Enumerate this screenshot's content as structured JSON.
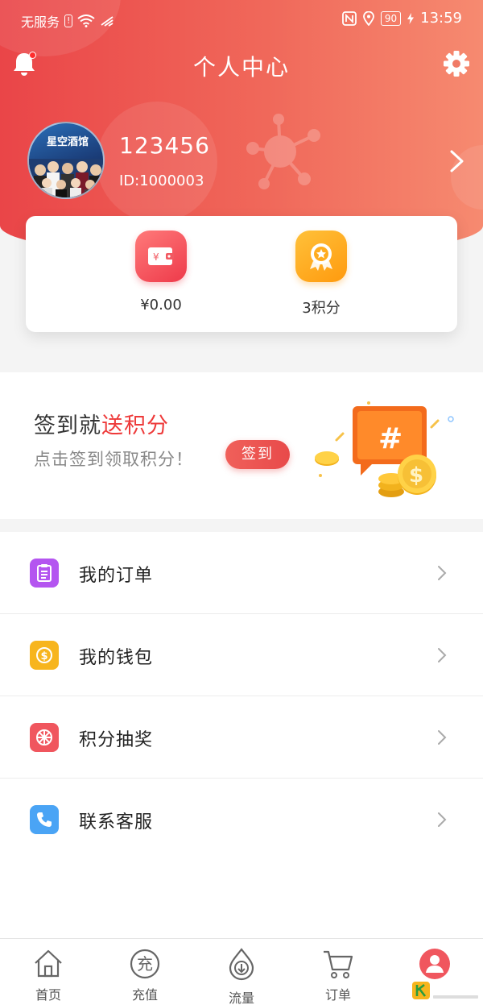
{
  "status_bar": {
    "carrier": "无服务",
    "time": "13:59",
    "battery": "90"
  },
  "nav": {
    "title": "个人中心"
  },
  "profile": {
    "avatar_banner": "星空酒馆",
    "username": "123456",
    "user_id": "ID:1000003"
  },
  "wallet_card": {
    "balance": "¥0.00",
    "points": "3积分"
  },
  "signin": {
    "title_prefix": "签到就",
    "title_highlight": "送积分",
    "subtitle": "点击签到领取积分！",
    "button_label": "签到"
  },
  "menu": [
    {
      "label": "我的订单",
      "icon": "clipboard-icon",
      "color": "#b455f0"
    },
    {
      "label": "我的钱包",
      "icon": "wallet-coin-icon",
      "color": "#f7b51d"
    },
    {
      "label": "积分抽奖",
      "icon": "lottery-wheel-icon",
      "color": "#f0565e"
    },
    {
      "label": "联系客服",
      "icon": "phone-icon",
      "color": "#4aa4f5"
    }
  ],
  "tabbar": [
    {
      "label": "首页",
      "icon": "home-icon"
    },
    {
      "label": "充值",
      "icon": "recharge-icon",
      "glyph": "充"
    },
    {
      "label": "流量",
      "icon": "traffic-icon"
    },
    {
      "label": "订单",
      "icon": "cart-icon"
    },
    {
      "label": "",
      "icon": "profile-icon"
    }
  ],
  "colors": {
    "header_start": "#ea4548",
    "header_end": "#f68a70",
    "accent": "#ee3a3a"
  }
}
